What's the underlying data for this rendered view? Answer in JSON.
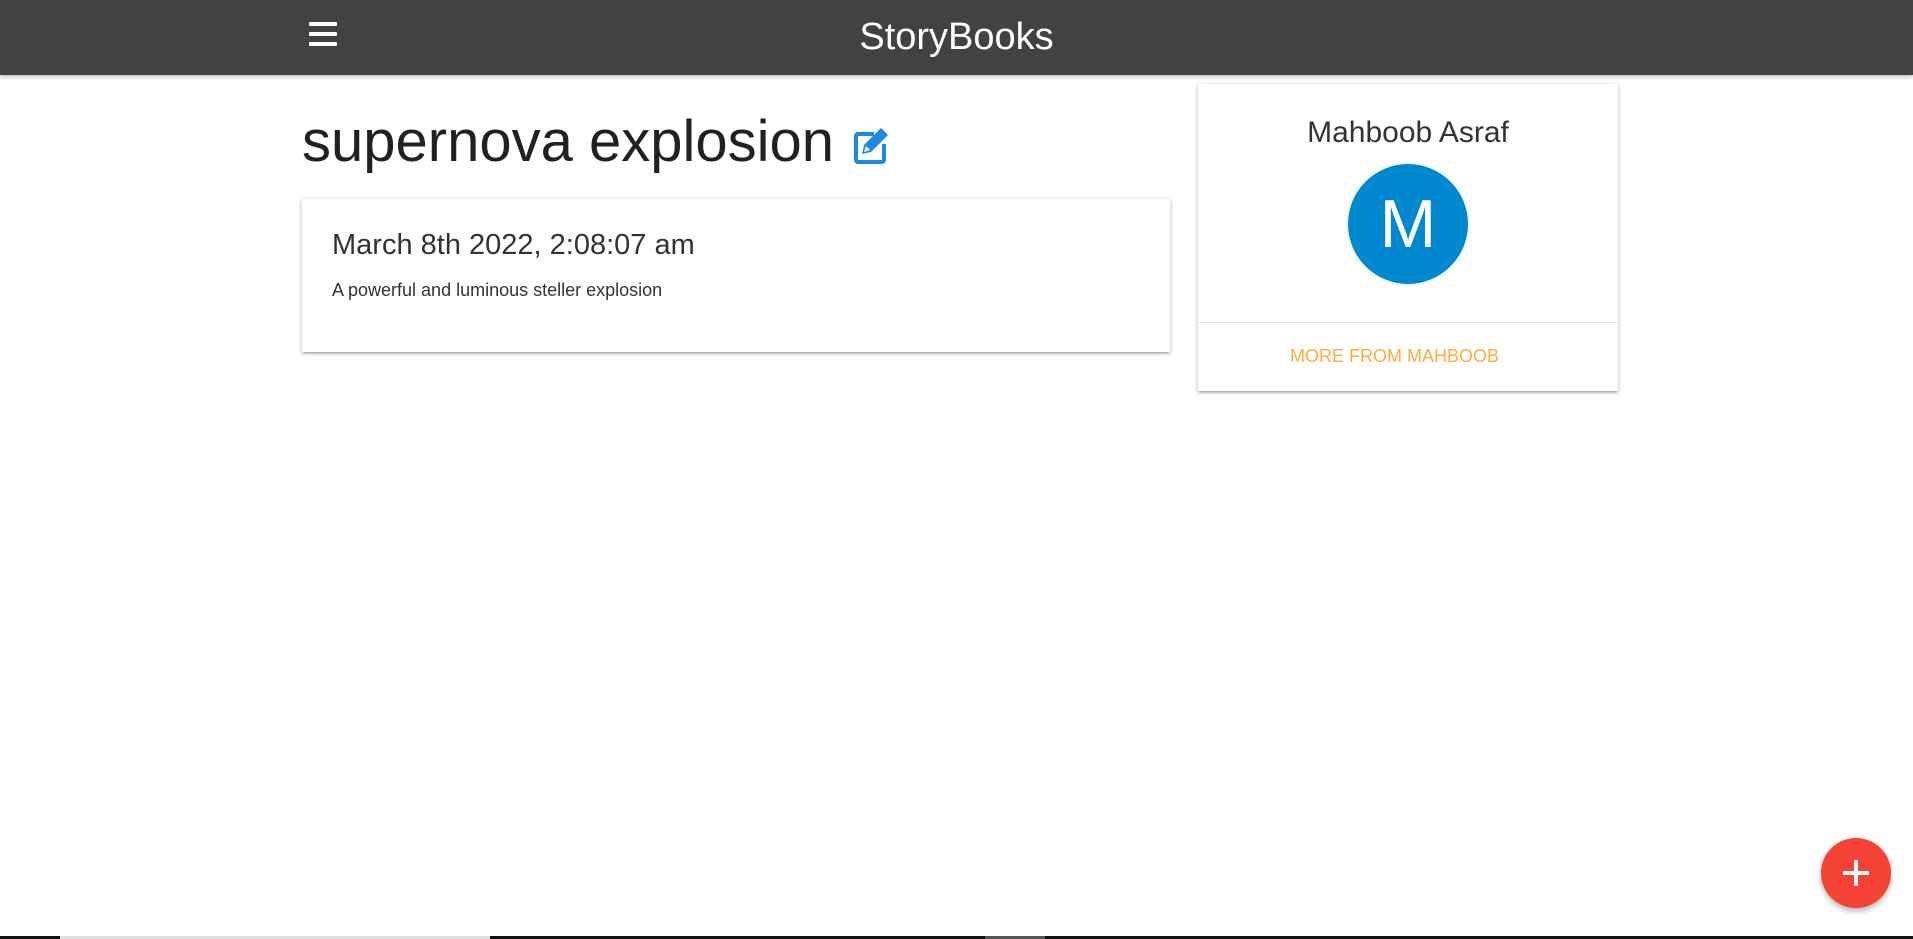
{
  "navbar": {
    "brand": "StoryBooks",
    "menu_icon": "hamburger-menu-icon",
    "background_color": "#424242"
  },
  "story": {
    "title": "supernova explosion",
    "edit_icon": "edit-pencil-square-icon",
    "date": "March 8th 2022, 2:08:07 am",
    "body": "A powerful and luminous steller explosion"
  },
  "author": {
    "name": "Mahboob Asraf",
    "avatar_initial": "M",
    "avatar_color": "#0288d1",
    "more_link": "MORE FROM MAHBOOB",
    "link_color": "#ffab40"
  },
  "fab": {
    "icon": "plus-icon",
    "color": "#f44336"
  },
  "accent_color": "#1e88e5"
}
